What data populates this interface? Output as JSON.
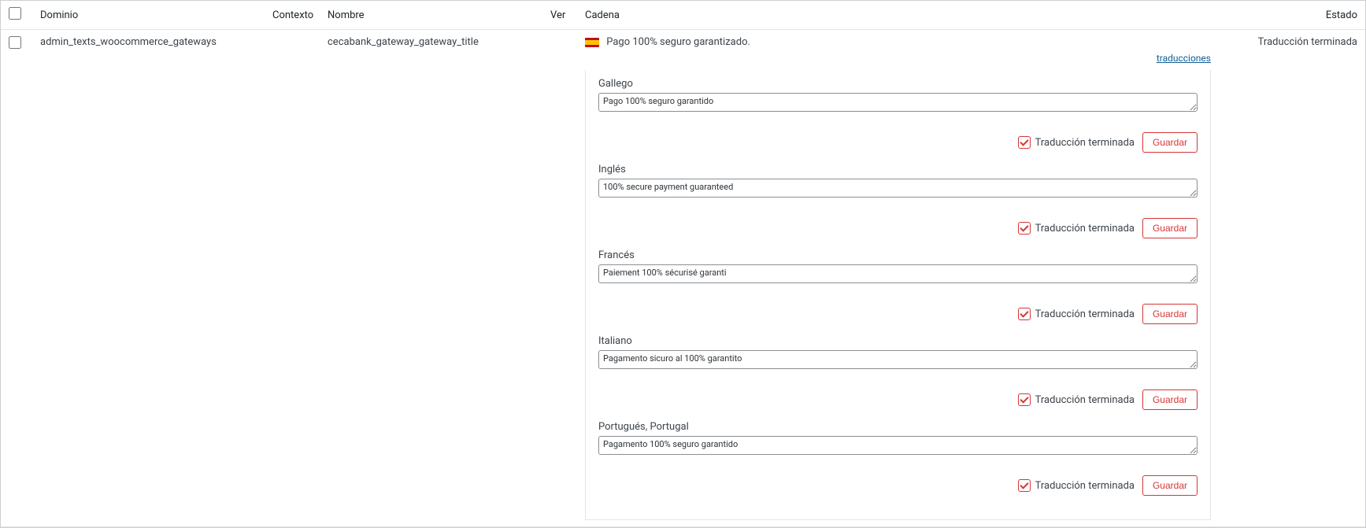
{
  "headers": {
    "dominio": "Dominio",
    "contexto": "Contexto",
    "nombre": "Nombre",
    "ver": "Ver",
    "cadena": "Cadena",
    "estado": "Estado"
  },
  "row": {
    "dominio": "admin_texts_woocommerce_gateways",
    "contexto": "",
    "nombre": "cecabank_gateway_gateway_title",
    "cadena": "Pago 100% seguro garantizado.",
    "estado": "Traducción terminada",
    "traducciones_link": "traducciones"
  },
  "status_label": "Traducción terminada",
  "save_label": "Guardar",
  "langs": [
    {
      "label": "Gallego",
      "value": "Pago 100% seguro garantido",
      "spell": false
    },
    {
      "label": "Inglés",
      "value": "100% secure payment guaranteed",
      "spell": true
    },
    {
      "label": "Francés",
      "value": "Paiement 100% sécurisé garanti",
      "spell": false
    },
    {
      "label": "Italiano",
      "value": "Pagamento sicuro al 100% garantito",
      "spell": false
    },
    {
      "label": "Portugués, Portugal",
      "value": "Pagamento 100% seguro garantido",
      "spell": false
    }
  ]
}
